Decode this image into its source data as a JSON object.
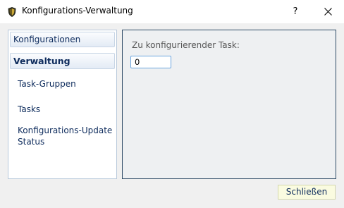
{
  "window": {
    "title": "Konfigurations-Verwaltung",
    "help_label": "?",
    "icon": "shield-icon"
  },
  "sidebar": {
    "headers": [
      {
        "label": "Konfigurationen"
      },
      {
        "label": "Verwaltung"
      }
    ],
    "items": [
      {
        "label": "Task-Gruppen"
      },
      {
        "label": "Tasks"
      },
      {
        "label": "Konfigurations-Update\nStatus"
      }
    ]
  },
  "main": {
    "field_label": "Zu konfigurierender Task:",
    "field_value": "0"
  },
  "footer": {
    "close_label": "Schließen"
  },
  "colors": {
    "panel_border": "#2d4a66",
    "sidebar_text": "#0d2b5c",
    "close_button_bg": "#fafbe0"
  }
}
